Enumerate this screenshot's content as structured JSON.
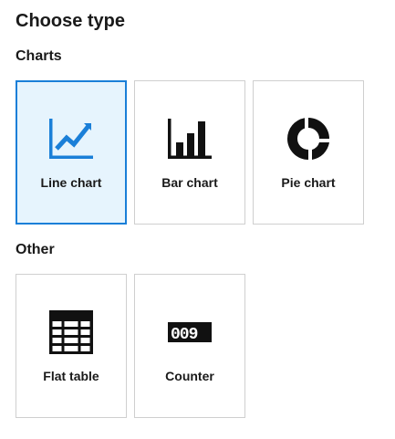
{
  "page": {
    "title": "Choose type"
  },
  "sections": [
    {
      "label": "Charts",
      "items": [
        {
          "label": "Line chart",
          "icon": "line-chart-icon",
          "selected": true
        },
        {
          "label": "Bar chart",
          "icon": "bar-chart-icon",
          "selected": false
        },
        {
          "label": "Pie chart",
          "icon": "pie-chart-icon",
          "selected": false
        }
      ]
    },
    {
      "label": "Other",
      "items": [
        {
          "label": "Flat table",
          "icon": "table-icon",
          "selected": false
        },
        {
          "label": "Counter",
          "icon": "counter-icon",
          "selected": false
        }
      ]
    }
  ],
  "colors": {
    "accent": "#1a7fd8",
    "selected_background": "#e6f4fd",
    "card_border": "#cfcfcf",
    "icon_dark": "#111111"
  },
  "counter_icon": {
    "digits": "009"
  }
}
